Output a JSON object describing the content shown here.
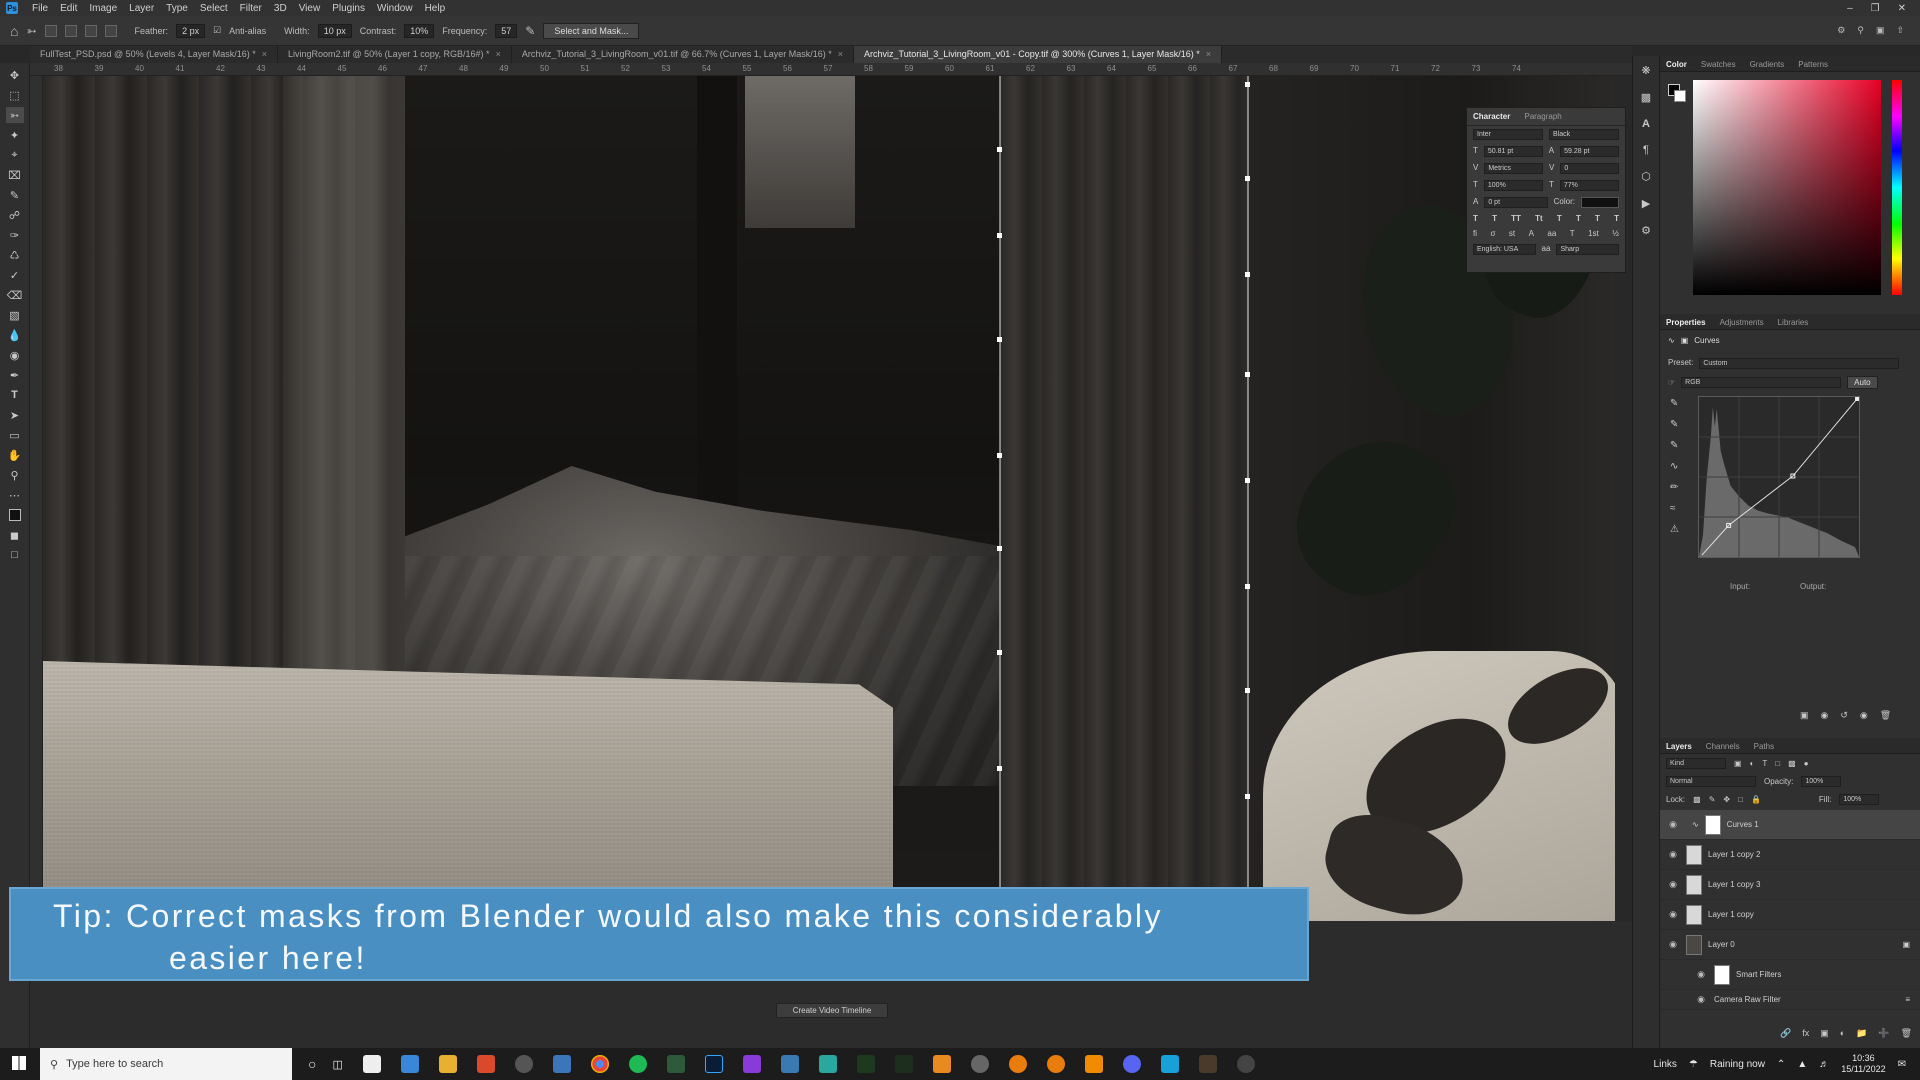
{
  "menubar": {
    "items": [
      "File",
      "Edit",
      "Image",
      "Layer",
      "Type",
      "Select",
      "Filter",
      "3D",
      "View",
      "Plugins",
      "Window",
      "Help"
    ]
  },
  "options_bar": {
    "feather_label": "Feather:",
    "feather_value": "2 px",
    "antialias_label": "Anti-alias",
    "width_label": "Width:",
    "width_value": "10 px",
    "contrast_label": "Contrast:",
    "contrast_value": "10%",
    "frequency_label": "Frequency:",
    "frequency_value": "57",
    "select_mask_label": "Select and Mask..."
  },
  "tabs": [
    {
      "label": "FullTest_PSD.psd @ 50% (Levels 4, Layer Mask/16) *"
    },
    {
      "label": "LivingRoom2.tif @ 50% (Layer 1 copy, RGB/16#) *"
    },
    {
      "label": "Archviz_Tutorial_3_LivingRoom_v01.tif @ 66.7% (Curves 1, Layer Mask/16) *"
    },
    {
      "label": "Archviz_Tutorial_3_LivingRoom_v01 - Copy.tif @ 300% (Curves 1, Layer Mask/16) *"
    }
  ],
  "ruler_ticks": [
    "38",
    "39",
    "40",
    "41",
    "42",
    "43",
    "44",
    "45",
    "46",
    "47",
    "48",
    "49",
    "50",
    "51",
    "52",
    "53",
    "54",
    "55",
    "56",
    "57",
    "58",
    "59",
    "60",
    "61",
    "62",
    "63",
    "64",
    "65",
    "66",
    "67",
    "68",
    "69",
    "70",
    "71",
    "72",
    "73",
    "74"
  ],
  "caption": {
    "line1": "Tip: Correct masks from Blender would also make this considerably",
    "line2": "easier here!"
  },
  "character_panel": {
    "tab_character": "Character",
    "tab_paragraph": "Paragraph",
    "font_family": "Inter",
    "font_style": "Black",
    "font_size": "50.81 pt",
    "leading": "59.28 pt",
    "kerning": "Metrics",
    "tracking": "0",
    "vertical_scale": "100%",
    "horizontal_scale": "77%",
    "baseline_shift": "0 pt",
    "color_label": "Color:",
    "language": "English: USA",
    "antialias": "Sharp"
  },
  "color_panel": {
    "tabs": [
      "Color",
      "Swatches",
      "Gradients",
      "Patterns"
    ]
  },
  "properties_panel": {
    "tabs": [
      "Properties",
      "Adjustments",
      "Libraries"
    ],
    "title": "Curves",
    "preset_label": "Preset:",
    "preset_value": "Custom",
    "channel": "RGB",
    "auto_label": "Auto",
    "input_label": "Input:",
    "output_label": "Output:"
  },
  "layers_panel": {
    "tabs": [
      "Layers",
      "Channels",
      "Paths"
    ],
    "filter_kind": "Kind",
    "blend_mode": "Normal",
    "opacity_label": "Opacity:",
    "opacity_value": "100%",
    "lock_label": "Lock:",
    "fill_label": "Fill:",
    "fill_value": "100%",
    "layers": [
      {
        "name": "Curves 1"
      },
      {
        "name": "Layer 1 copy 2"
      },
      {
        "name": "Layer 1 copy 3"
      },
      {
        "name": "Layer 1 copy"
      },
      {
        "name": "Layer 0"
      },
      {
        "name": "Smart Filters"
      },
      {
        "name": "Camera Raw Filter"
      }
    ]
  },
  "timeline": {
    "create_label": "Create Video Timeline"
  },
  "taskbar": {
    "search_placeholder": "Type here to search",
    "links_label": "Links",
    "weather": "Raining now",
    "time": "10:36",
    "date": "15/11/2022"
  }
}
